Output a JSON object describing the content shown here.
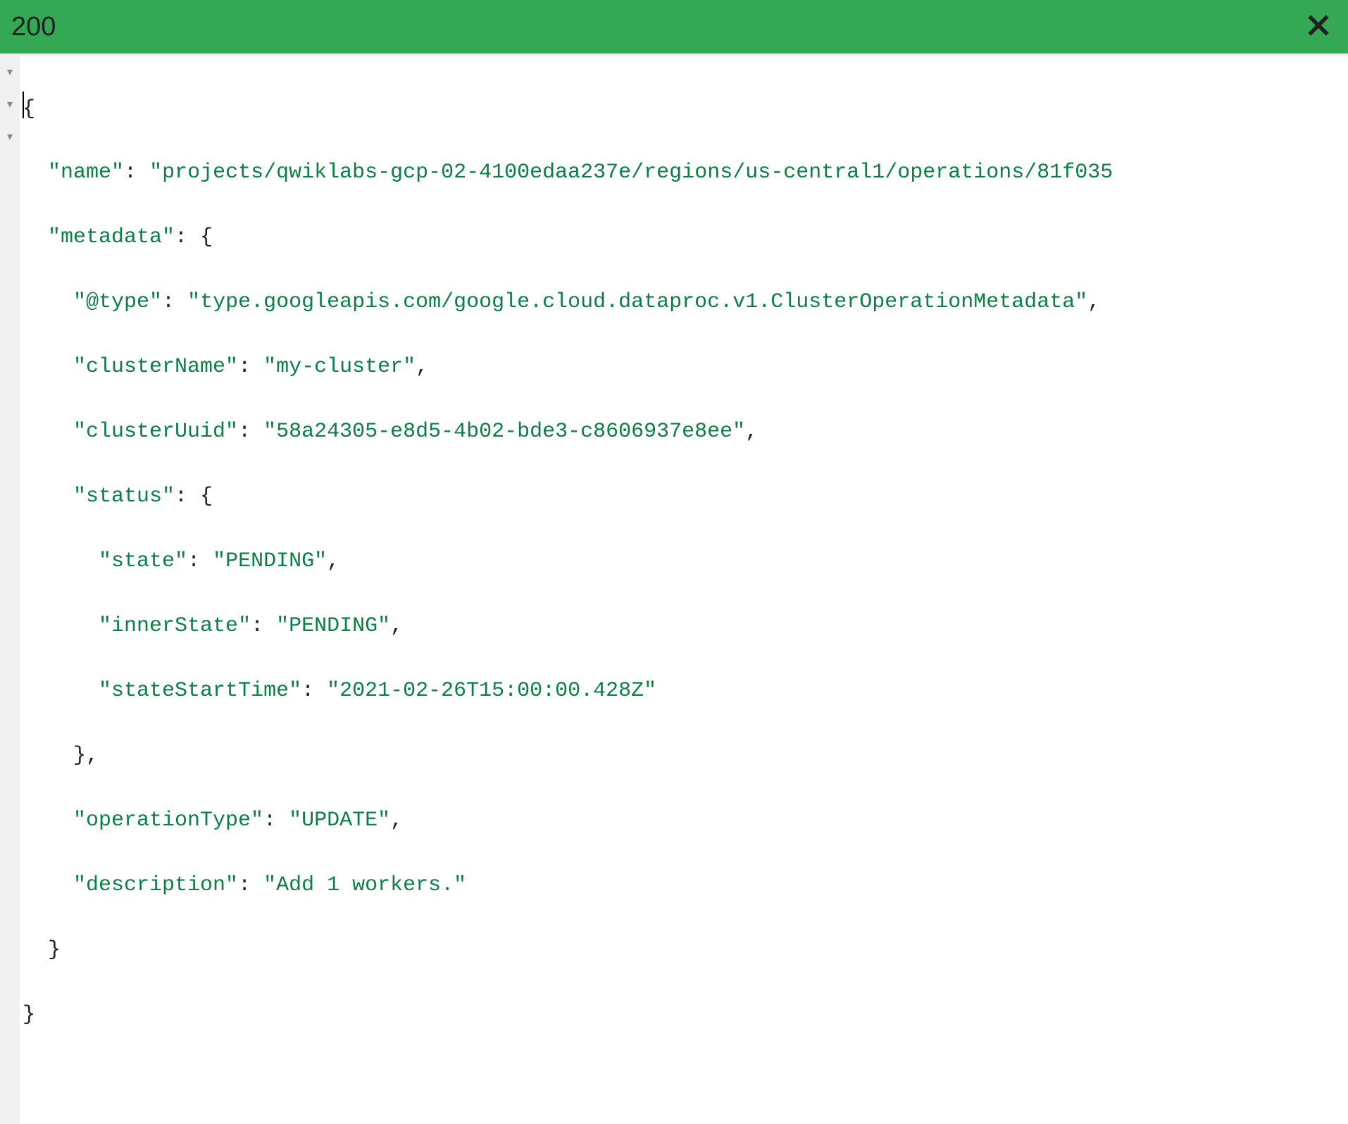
{
  "status_code": "200",
  "fold_marker": "▾",
  "json_payload": {
    "name": "projects/qwiklabs-gcp-02-4100edaa237e/regions/us-central1/operations/81f035",
    "metadata": {
      "@type": "type.googleapis.com/google.cloud.dataproc.v1.ClusterOperationMetadata",
      "clusterName": "my-cluster",
      "clusterUuid": "58a24305-e8d5-4b02-bde3-c8606937e8ee",
      "status": {
        "state": "PENDING",
        "innerState": "PENDING",
        "stateStartTime": "2021-02-26T15:00:00.428Z"
      },
      "operationType": "UPDATE",
      "description": "Add 1 workers."
    }
  },
  "lines": {
    "l1_open": "{",
    "l2_key": "\"name\"",
    "l2_val": "\"projects/qwiklabs-gcp-02-4100edaa237e/regions/us-central1/operations/81f035",
    "l3_key": "\"metadata\"",
    "l3_open": "{",
    "l4_key": "\"@type\"",
    "l4_val": "\"type.googleapis.com/google.cloud.dataproc.v1.ClusterOperationMetadata\"",
    "l5_key": "\"clusterName\"",
    "l5_val": "\"my-cluster\"",
    "l6_key": "\"clusterUuid\"",
    "l6_val": "\"58a24305-e8d5-4b02-bde3-c8606937e8ee\"",
    "l7_key": "\"status\"",
    "l7_open": "{",
    "l8_key": "\"state\"",
    "l8_val": "\"PENDING\"",
    "l9_key": "\"innerState\"",
    "l9_val": "\"PENDING\"",
    "l10_key": "\"stateStartTime\"",
    "l10_val": "\"2021-02-26T15:00:00.428Z\"",
    "l11_close": "},",
    "l12_key": "\"operationType\"",
    "l12_val": "\"UPDATE\"",
    "l13_key": "\"description\"",
    "l13_val": "\"Add 1 workers.\"",
    "l14_close": "}",
    "l15_close": "}"
  }
}
